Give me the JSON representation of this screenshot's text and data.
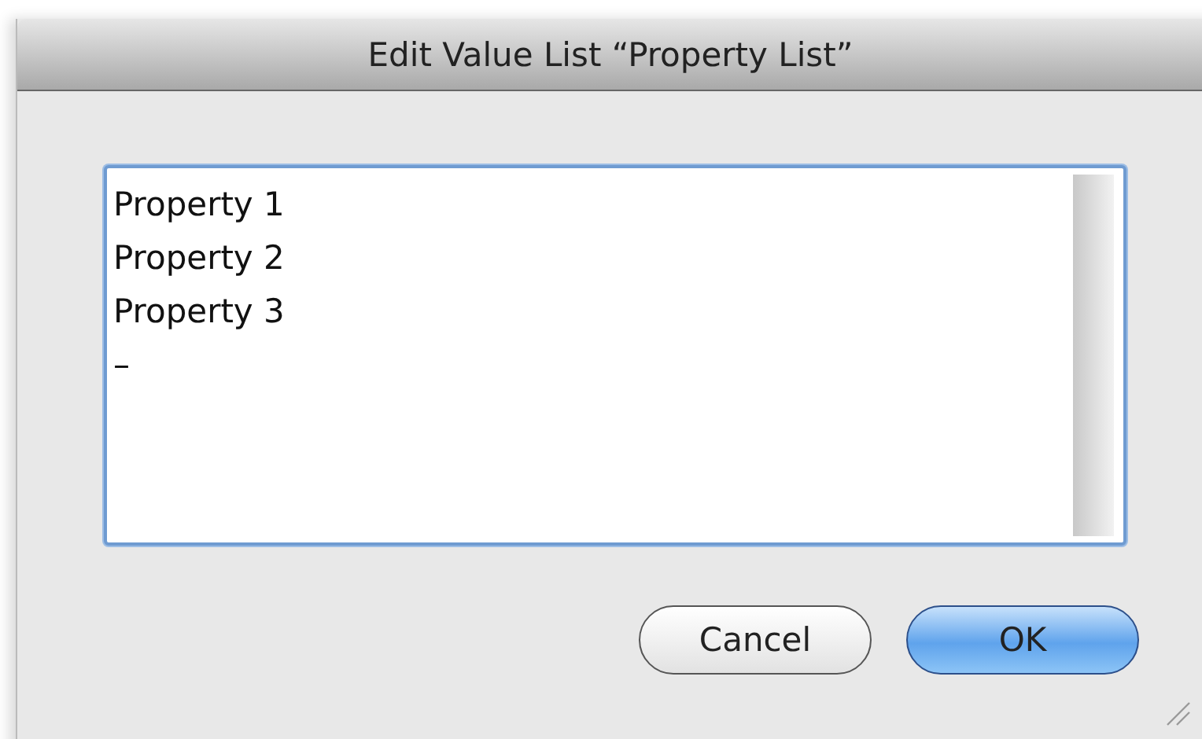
{
  "window": {
    "title": "Edit Value List “Property List”"
  },
  "text_area": {
    "lines": [
      "Property 1",
      "Property 2",
      "Property 3",
      "–"
    ],
    "focused": true
  },
  "buttons": [
    {
      "label": "Cancel",
      "default": false
    },
    {
      "label": "OK",
      "default": true
    }
  ]
}
